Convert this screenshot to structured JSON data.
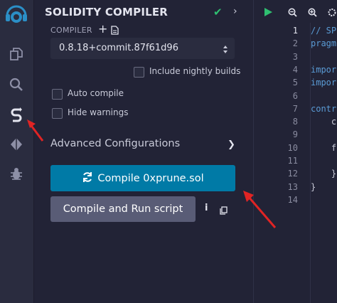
{
  "panel": {
    "title": "SOLIDITY COMPILER",
    "compiler_label": "COMPILER",
    "compiler_version": "0.8.18+commit.87f61d96",
    "nightly_label": "Include nightly builds",
    "auto_compile_label": "Auto compile",
    "hide_warnings_label": "Hide warnings",
    "advanced_label": "Advanced Configurations",
    "compile_button": "Compile 0xprune.sol",
    "run_button": "Compile and Run script"
  },
  "editor": {
    "line_numbers": [
      "1",
      "2",
      "3",
      "4",
      "5",
      "6",
      "7",
      "8",
      "9",
      "10",
      "11",
      "12",
      "13",
      "14"
    ],
    "code_lines": [
      {
        "text": "// SP",
        "color": "#5a9bd5"
      },
      {
        "text": "pragm",
        "color": "#5a9bd5"
      },
      {
        "text": "",
        "color": "#c9cbd9"
      },
      {
        "text": "impor",
        "color": "#5a9bd5"
      },
      {
        "text": "impor",
        "color": "#5a9bd5"
      },
      {
        "text": "",
        "color": "#c9cbd9"
      },
      {
        "text": "contr",
        "color": "#5a9bd5"
      },
      {
        "text": "    c",
        "color": "#c9cbd9"
      },
      {
        "text": "",
        "color": "#c9cbd9"
      },
      {
        "text": "    f",
        "color": "#c9cbd9"
      },
      {
        "text": "    ",
        "color": "#c9cbd9"
      },
      {
        "text": "    }",
        "color": "#c9cbd9"
      },
      {
        "text": "}",
        "color": "#c9cbd9"
      },
      {
        "text": "",
        "color": "#c9cbd9"
      }
    ]
  },
  "colors": {
    "accent": "#007aa6",
    "success": "#2fbf71",
    "annotation_arrow": "#e02424"
  }
}
